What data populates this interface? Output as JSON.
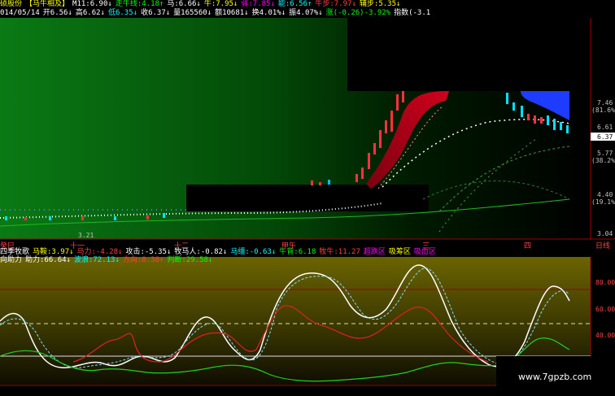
{
  "header": {
    "row1": [
      {
        "text": "硕股份",
        "color": "#ffff00"
      },
      {
        "text": "【马牛相及】",
        "color": "#ffff00"
      },
      {
        "text": "M11:6.90↓",
        "color": "#ffffff"
      },
      {
        "text": "走牛线:4.18↑",
        "color": "#00ff00"
      },
      {
        "text": "马:6.66↓",
        "color": "#ffffff"
      },
      {
        "text": "牛:7.95↓",
        "color": "#ffff00"
      },
      {
        "text": "驿:7.85↓",
        "color": "#ff00ff"
      },
      {
        "text": "能:6.56↑",
        "color": "#00ffff"
      },
      {
        "text": "牛步:7.97↓",
        "color": "#ff4040"
      },
      {
        "text": "辅步:5.35↓",
        "color": "#ffff00"
      }
    ],
    "row2": [
      {
        "text": "014/05/14",
        "color": "#ffffff"
      },
      {
        "text": "开6.56↓",
        "color": "#ffffff"
      },
      {
        "text": "高6.62↓",
        "color": "#ffffff"
      },
      {
        "text": "低6.35↓",
        "color": "#00ffff"
      },
      {
        "text": "收6.37↓",
        "color": "#ffffff"
      },
      {
        "text": "量165560↓",
        "color": "#ffffff"
      },
      {
        "text": "额10681↓",
        "color": "#ffffff"
      },
      {
        "text": "换4.01%↓",
        "color": "#ffffff"
      },
      {
        "text": "振4.07%↓",
        "color": "#ffffff"
      },
      {
        "text": "涨(-0.26)-3.92%",
        "color": "#00ff00"
      },
      {
        "text": "指数(-3.1",
        "color": "#ffffff"
      }
    ]
  },
  "price_axis": [
    {
      "label": "7.46",
      "color": "#c0c0c0"
    },
    {
      "label": "(81.6%)",
      "color": "#c0c0c0"
    },
    {
      "label": "6.61",
      "color": "#c0c0c0"
    },
    {
      "label": "6.37",
      "color": "#000000"
    },
    {
      "label": "5.77",
      "color": "#c0c0c0"
    },
    {
      "label": "(38.2%)",
      "color": "#c0c0c0"
    },
    {
      "label": "4.40",
      "color": "#c0c0c0"
    },
    {
      "label": "(19.1%)",
      "color": "#c0c0c0"
    },
    {
      "label": "3.04",
      "color": "#c0c0c0"
    }
  ],
  "low_marker": "3.21",
  "date_axis": {
    "ticks": [
      "癸巳",
      "十一",
      "十二",
      "甲午",
      "三",
      "四"
    ],
    "button": "日线"
  },
  "indicator_header": {
    "row1": [
      {
        "text": "四季牧歌",
        "color": "#ffffff"
      },
      {
        "text": "马鞍:3.97↓",
        "color": "#ffff00"
      },
      {
        "text": "马力:-4.28↓",
        "color": "#ff4040"
      },
      {
        "text": "攻击:-5.35↓",
        "color": "#ffffff"
      },
      {
        "text": "牧马人:-0.82↓",
        "color": "#ffffff"
      },
      {
        "text": "马缰:-0.63↓",
        "color": "#00ffff"
      },
      {
        "text": "牛背:6.18",
        "color": "#00ff00"
      },
      {
        "text": "牧牛:11.27",
        "color": "#ff4040"
      },
      {
        "text": "超跌区",
        "color": "#ff00ff"
      },
      {
        "text": "吸筹区",
        "color": "#ffff00"
      },
      {
        "text": "吸血区",
        "color": "#ff00ff"
      }
    ],
    "row2": [
      {
        "text": "向助力",
        "color": "#ffffff"
      },
      {
        "text": "助力:66.64↓",
        "color": "#ffffff"
      },
      {
        "text": "波浪:72.13↓",
        "color": "#00ffff"
      },
      {
        "text": "方向:8.38↑",
        "color": "#ff4040"
      },
      {
        "text": "判断:29.58↓",
        "color": "#00ff00"
      }
    ]
  },
  "indicator_axis": [
    "80.00",
    "60.00",
    "40.00"
  ],
  "watermark": "www.7gpzb.com"
}
